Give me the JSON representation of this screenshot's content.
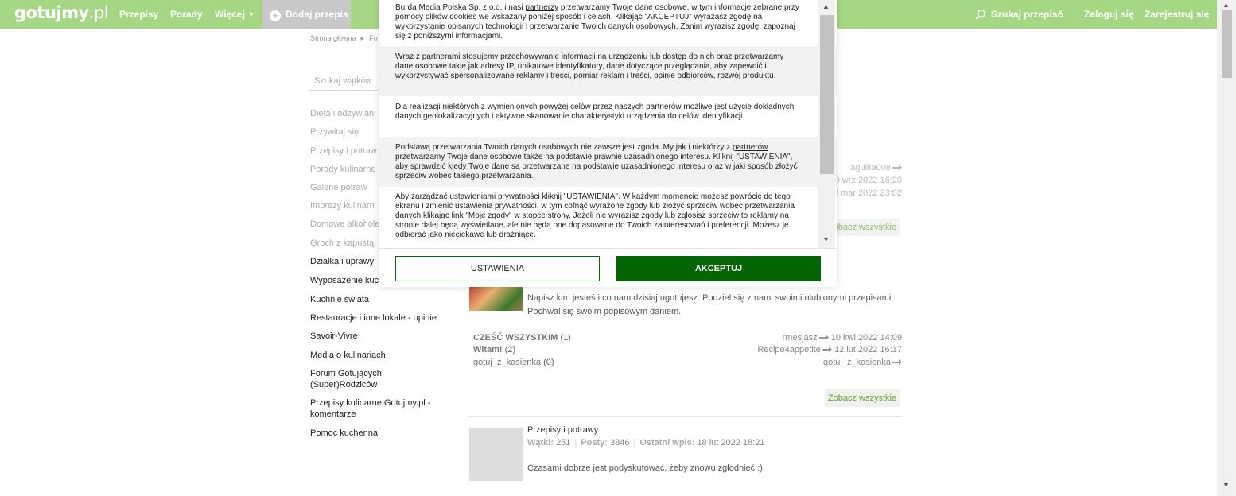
{
  "header": {
    "logo_main": "gotujmy",
    "logo_suffix": ".pl",
    "nav": [
      "Przepisy",
      "Porady",
      "Więcej"
    ],
    "add_recipe": "Dodaj przepis",
    "search_placeholder": "Szukaj przepisó",
    "login": "Zaloguj się",
    "register": "Zarejestruj się"
  },
  "breadcrumb": [
    "Strona główna",
    "Fo"
  ],
  "sidebar": {
    "search_placeholder": "Szukaj wątków",
    "items": [
      "Dieta i odżywiani",
      "Przywitaj się",
      "Przepisy i potraw",
      "Porady kulinarne",
      "Galerie potraw",
      "Imprezy kulinarn",
      "Domowe alkohole",
      "Groch z kapustą",
      "Działka i uprawy",
      "Wyposażenie kuc",
      "Kuchnie świata",
      "Restauracje i inne lokale - opinie",
      "Savoir-Vivre",
      "Media o kulinariach",
      "Forum Gotujących (Super)Rodziców",
      "Przepisy kulinarne Gotujmy.pl - komentarze",
      "Pomoc kuchenna"
    ]
  },
  "forum_top": {
    "meta": [
      {
        "text": "agulka008"
      },
      {
        "text": "9 wrz 2022 16:20"
      },
      {
        "text": "0 mar 2022 23:02"
      }
    ],
    "see_all": "Zobacz wszystkie"
  },
  "forum_przywitaj": {
    "description": "Napisz kim jesteś i co nam dzisiaj ugotujesz. Podziel się z nami swoimi ulubionymi przepisami. Pochwal się swoim popisowym daniem.",
    "threads": [
      {
        "name": "CZEŚĆ WSZYSTKIM",
        "count": "(1)",
        "user": "rmesjasz",
        "date": "10 kwi 2022 14:09"
      },
      {
        "name": "Witam!",
        "count": "(2)",
        "user": "Recipe4appetite",
        "date": "12 lut 2022 16:17"
      },
      {
        "name": "gotuj_z_kasienka",
        "count": "(0)",
        "user": "gotuj_z_kasienka",
        "date": ""
      }
    ],
    "see_all": "Zobacz wszystkie"
  },
  "forum_przepisy": {
    "title": "Przepisy i potrawy",
    "threads_label": "Wątki:",
    "threads_value": "251",
    "posts_label": "Posty:",
    "posts_value": "3846",
    "last_label": "Ostatni wpis:",
    "last_value": "18 lut 2022 18:21",
    "description": "Czasami dobrze jest podyskutować, żeby znowu zgłodnieć :)"
  },
  "cookie_modal": {
    "p1_a": "Burda Media Polska Sp. z o.o. i nasi ",
    "p1_link": "partnerzy",
    "p1_b": " przetwarzamy Twoje dane osobowe, w tym informacje zebrane przy pomocy plików cookies we wskazany poniżej sposób i celach. Klikając \"AKCEPTUJ\" wyrażasz zgodę na wykorzystanie opisanych technologii i przetwarzanie Twoich danych osobowych. Zanim wyrazisz zgodę, zapoznaj się z poniższymi informacjami.",
    "p2_a": "Wraz z ",
    "p2_link": "partnerami",
    "p2_b": " stosujemy przechowywanie informacji na urządzeniu lub dostęp do nich oraz przetwarzamy dane osobowe takie jak adresy IP, unikatowe identyfikatory, dane dotyczące przeglądania, aby zapewnić i wykorzystywać spersonalizowane reklamy i treści, pomiar reklam i treści, opinie odbiorców, rozwój produktu.",
    "p3_a": "Dla realizacji niektórych z wymienionych powyżej celów przez naszych ",
    "p3_link": "partnerów",
    "p3_b": " możliwe jest użycie dokładnych danych geolokalizacyjnych i aktywne skanowanie charakterystyki urządzenia do celów identyfikacji.",
    "p4_a": "Podstawą przetwarzania Twoich danych osobowych nie zawsze jest zgoda. My jak i niektórzy z ",
    "p4_link": "partnerów",
    "p4_b": " przetwarzamy Twoje dane osobowe także na podstawie prawnie uzasadnionego interesu. Kliknij \"USTAWIENIA\", aby sprawdzić kiedy Twoje dane są przetwarzane na podstawie uzasadnionego interesu oraz w jaki sposób złożyć sprzeciw wobec takiego przetwarzania.",
    "p5": "Aby zarządzać ustawieniami prywatności kliknij \"USTAWIENIA\". W każdym momencie możesz powrócić do tego ekranu i zmienić ustawienia prywatności, w tym cofnąć wyrażone zgody lub złożyć sprzeciw wobec przetwarzania danych klikając link \"Moje zgody\" w stopce strony. Jeżeli nie wyrazisz zgody lub zgłosisz sprzeciw to reklamy na stronie dalej będą wyświetlane, ale nie będą one dopasowane do Twoich zainteresowań i preferencji. Możesz je odbierać jako nieciekawe lub drażniące.",
    "settings_button": "USTAWIENIA",
    "accept_button": "AKCEPTUJ"
  }
}
